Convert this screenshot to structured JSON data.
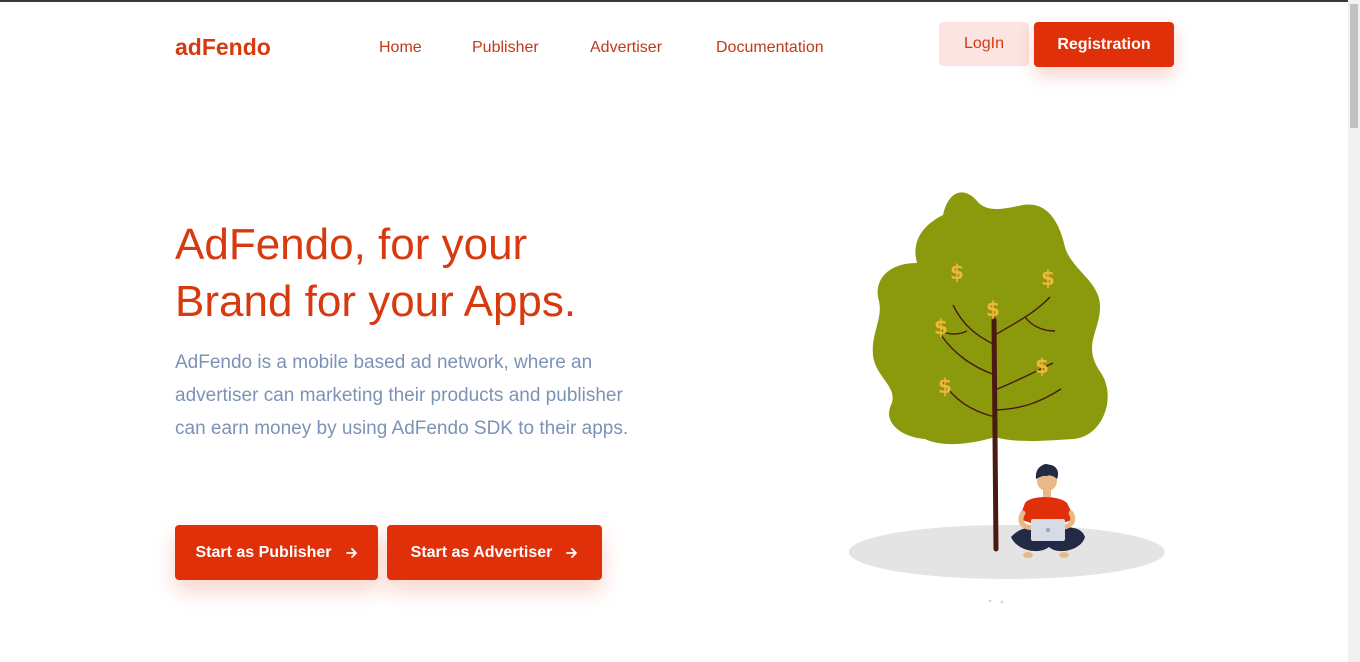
{
  "brand": {
    "logo": "adFendo"
  },
  "nav": {
    "items": [
      {
        "label": "Home"
      },
      {
        "label": "Publisher"
      },
      {
        "label": "Advertiser"
      },
      {
        "label": "Documentation"
      }
    ]
  },
  "auth": {
    "login_label": "LogIn",
    "register_label": "Registration"
  },
  "hero": {
    "title_line1": "AdFendo, for your",
    "title_line2": "Brand for your Apps.",
    "description": "AdFendo is a mobile based ad network, where an advertiser can marketing their products and publisher can earn money by using AdFendo SDK to their apps.",
    "cta_publisher": "Start as Publisher",
    "cta_advertiser": "Start as Advertiser"
  },
  "icons": {
    "cta_arrow": "arrow-right-icon",
    "illustration": "money-tree-illustration"
  },
  "colors": {
    "brand": "#e0300a",
    "brand_text": "#d83a10",
    "login_bg": "#fbe4e1",
    "description": "#7b93b6",
    "tree": "#8a9a0c",
    "dollar": "#f0b63a"
  }
}
